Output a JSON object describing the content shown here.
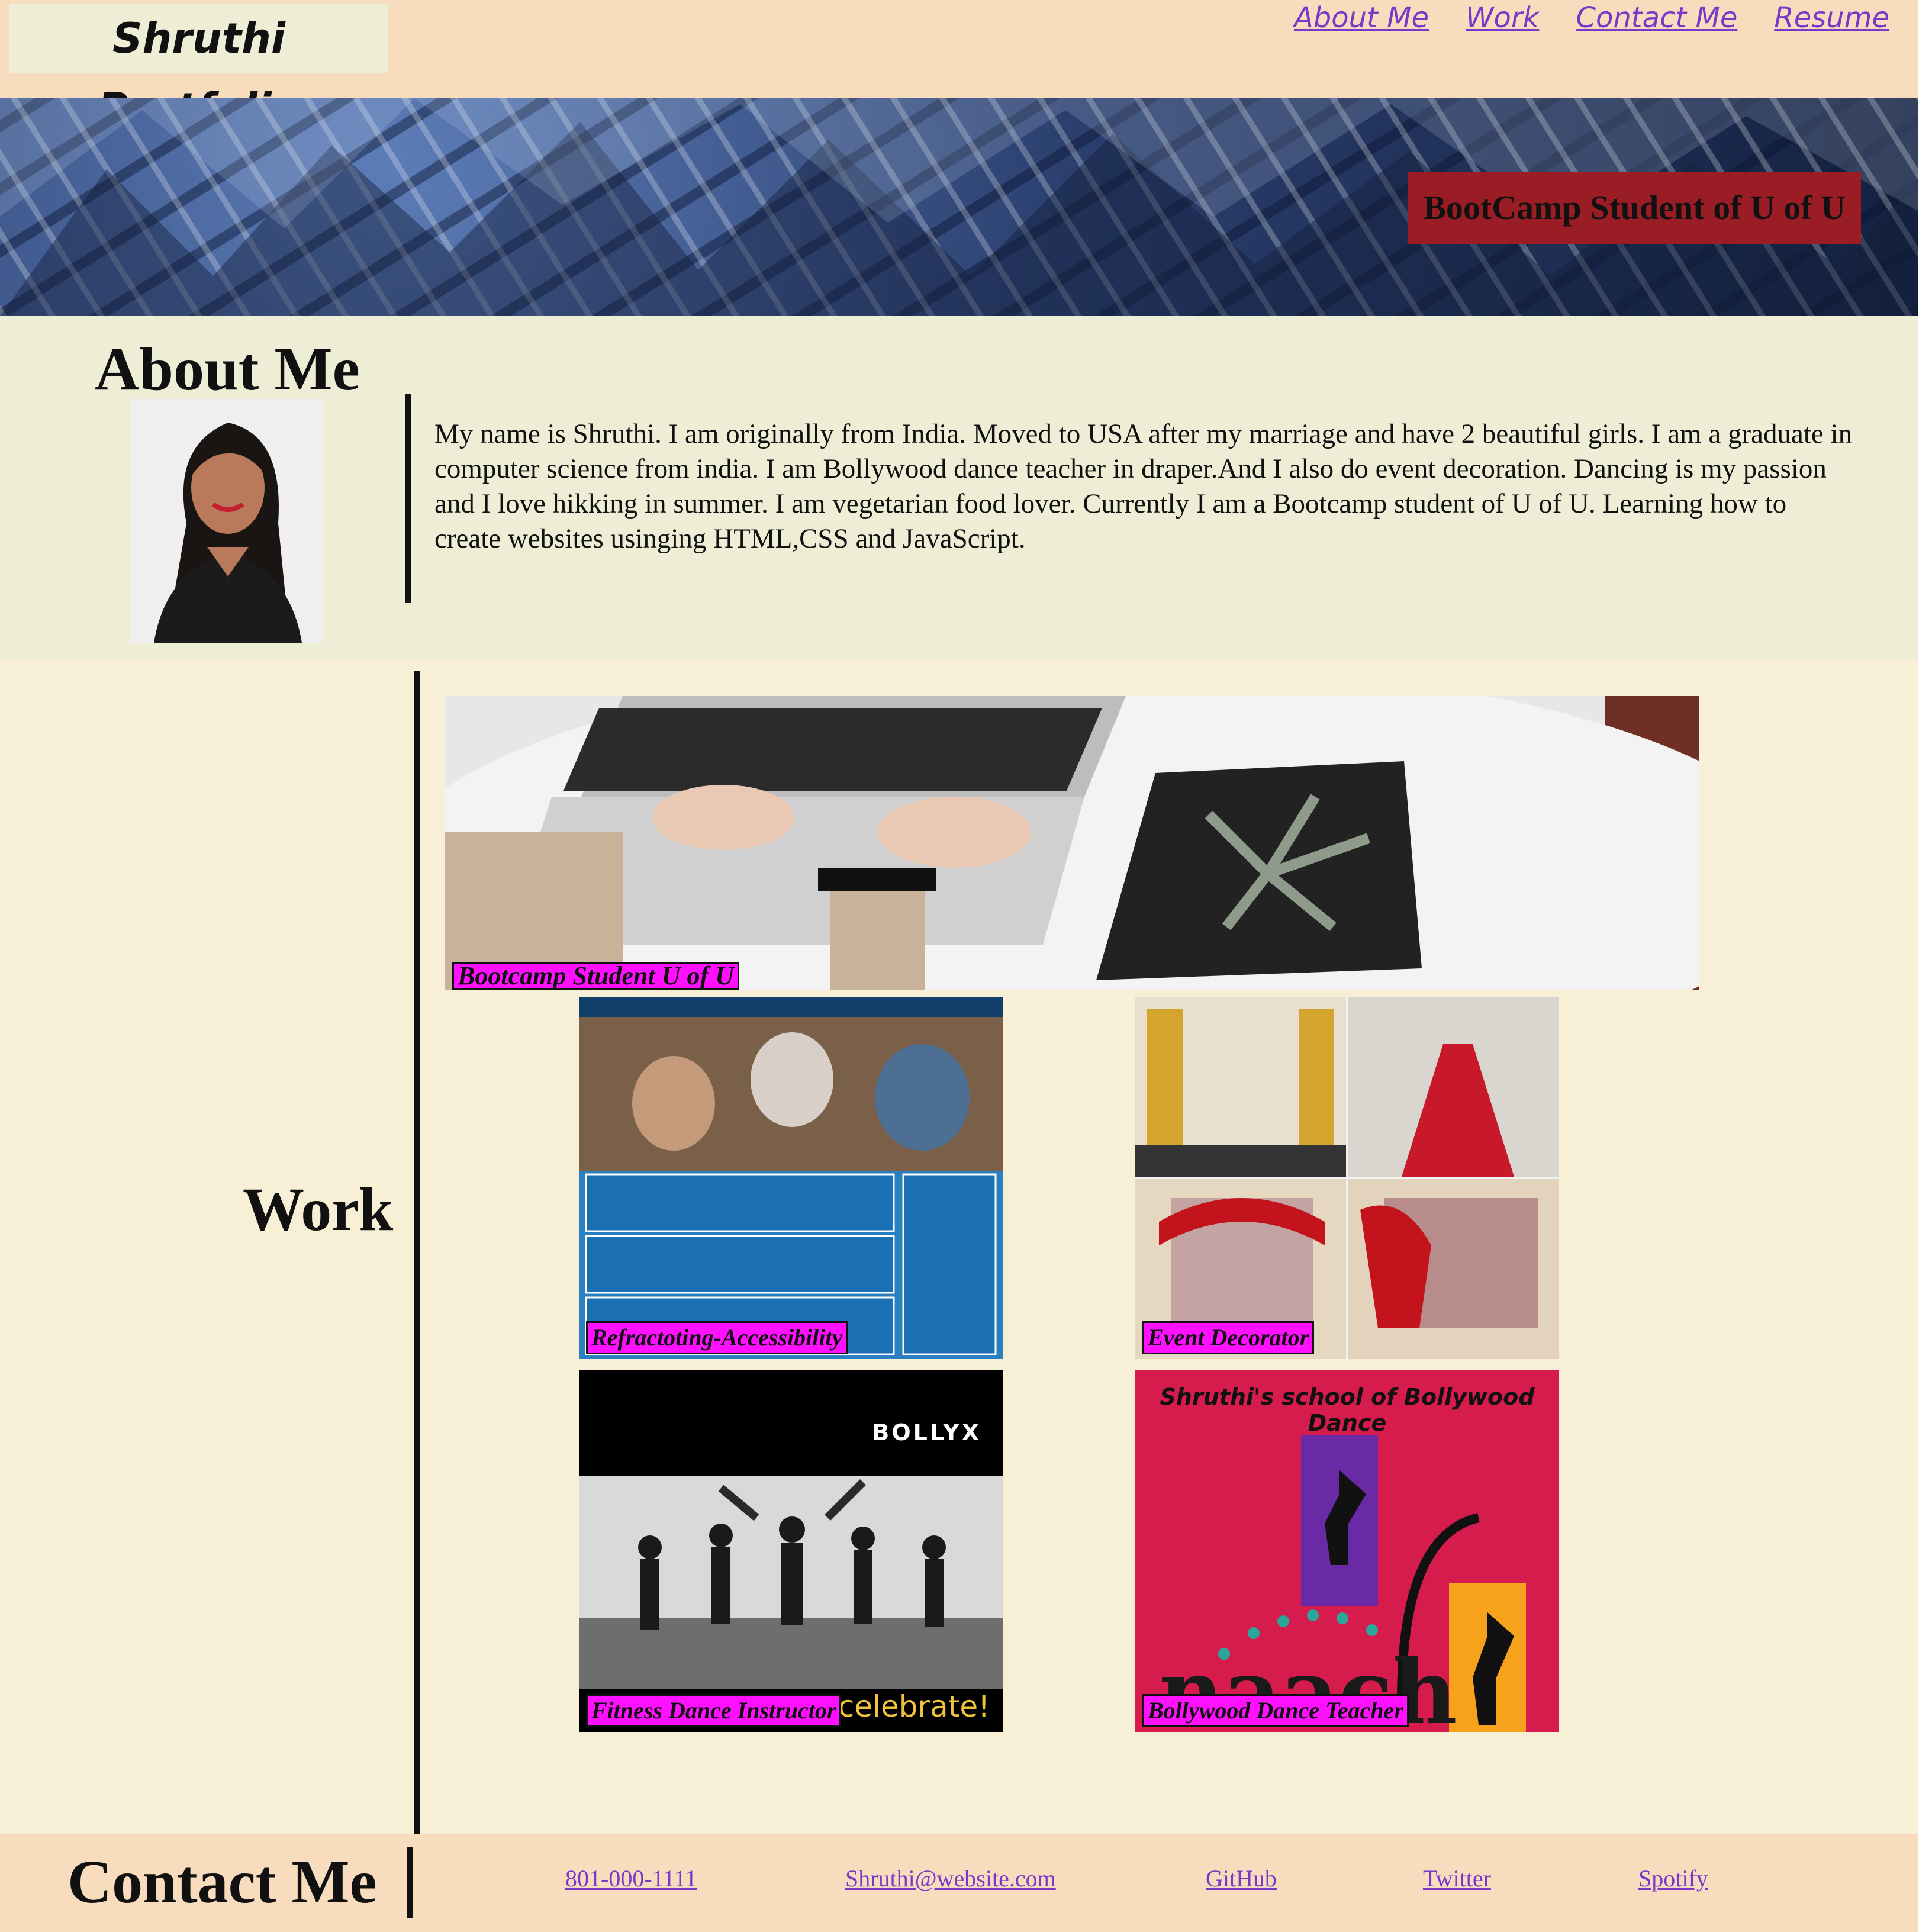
{
  "header": {
    "brand": "Shruthi Portfolio",
    "nav": [
      "About Me",
      "Work",
      "Contact Me",
      "Resume"
    ]
  },
  "hero": {
    "badge": "BootCamp Student of U of U"
  },
  "about": {
    "title": "About Me",
    "text": "My name is Shruthi. I am originally from India. Moved to USA after my marriage and have 2 beautiful girls. I am a graduate in computer science from india. I am Bollywood dance teacher in draper.And I also do event decoration. Dancing is my passion and I love hikking in summer. I am vegetarian food lover. Currently I am a Bootcamp student of U of U. Learning how to create websites usinging HTML,CSS and JavaScript."
  },
  "work": {
    "title": "Work",
    "featured_label": "Bootcamp Student U of U",
    "tiles": [
      {
        "label": "Refractoting-Accessibility"
      },
      {
        "label": "Event Decorator"
      },
      {
        "label": "Fitness Dance Instructor",
        "brand": "BOLLYX",
        "tagline": "The best way to celebrate!"
      },
      {
        "label": "Bollywood Dance Teacher",
        "heading": "Shruthi's school of Bollywood Dance",
        "logo": "naach"
      }
    ]
  },
  "contact": {
    "title": "Contact Me",
    "links": [
      "801-000-1111",
      "Shruthi@website.com",
      "GitHub",
      "Twitter",
      "Spotify"
    ]
  }
}
